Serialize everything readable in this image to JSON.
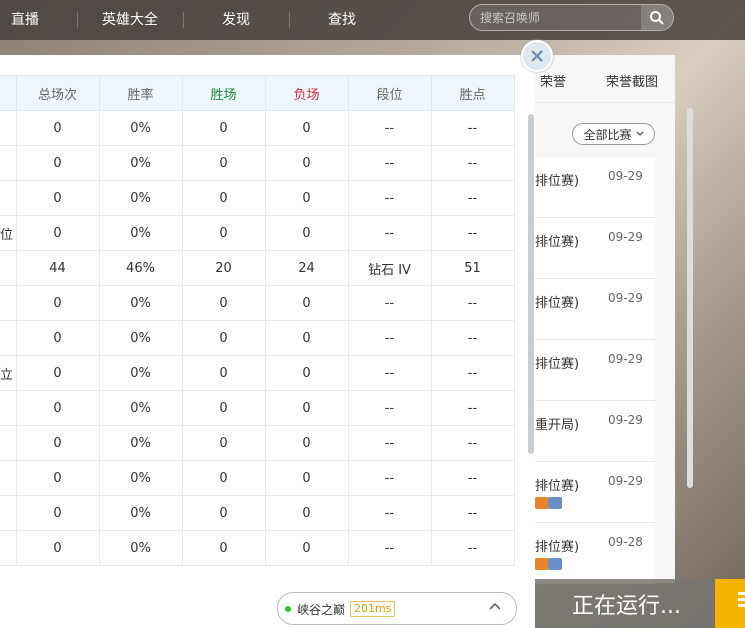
{
  "nav": {
    "items": [
      "直播",
      "英雄大全",
      "发现",
      "查找"
    ],
    "search_placeholder": "搜索召唤师"
  },
  "side": {
    "tabs": [
      "荣誉",
      "荣誉截图"
    ],
    "filter_label": "全部比赛",
    "matches": [
      {
        "name": "排位赛)",
        "date": "09-29"
      },
      {
        "name": "排位赛)",
        "date": "09-29"
      },
      {
        "name": "排位赛)",
        "date": "09-29"
      },
      {
        "name": "排位赛)",
        "date": "09-29"
      },
      {
        "name": "重开局)",
        "date": "09-29"
      },
      {
        "name": "排位赛)",
        "date": "09-29"
      },
      {
        "name": "排位赛)",
        "date": "09-28"
      }
    ]
  },
  "running_label": "正在运行...",
  "table": {
    "headers": [
      "总场次",
      "胜率",
      "胜场",
      "负场",
      "段位",
      "胜点"
    ],
    "rows": [
      {
        "mode": "",
        "total": "0",
        "rate": "0%",
        "win": "0",
        "lose": "0",
        "tier": "--",
        "points": "--"
      },
      {
        "mode": "",
        "total": "0",
        "rate": "0%",
        "win": "0",
        "lose": "0",
        "tier": "--",
        "points": "--"
      },
      {
        "mode": "",
        "total": "0",
        "rate": "0%",
        "win": "0",
        "lose": "0",
        "tier": "--",
        "points": "--"
      },
      {
        "mode": "位",
        "total": "0",
        "rate": "0%",
        "win": "0",
        "lose": "0",
        "tier": "--",
        "points": "--"
      },
      {
        "mode": "",
        "total": "44",
        "rate": "46%",
        "win": "20",
        "lose": "24",
        "tier": "钻石 IV",
        "points": "51"
      },
      {
        "mode": "",
        "total": "0",
        "rate": "0%",
        "win": "0",
        "lose": "0",
        "tier": "--",
        "points": "--"
      },
      {
        "mode": "",
        "total": "0",
        "rate": "0%",
        "win": "0",
        "lose": "0",
        "tier": "--",
        "points": "--"
      },
      {
        "mode": "立",
        "total": "0",
        "rate": "0%",
        "win": "0",
        "lose": "0",
        "tier": "--",
        "points": "--"
      },
      {
        "mode": "",
        "total": "0",
        "rate": "0%",
        "win": "0",
        "lose": "0",
        "tier": "--",
        "points": "--"
      },
      {
        "mode": "",
        "total": "0",
        "rate": "0%",
        "win": "0",
        "lose": "0",
        "tier": "--",
        "points": "--"
      },
      {
        "mode": "",
        "total": "0",
        "rate": "0%",
        "win": "0",
        "lose": "0",
        "tier": "--",
        "points": "--"
      },
      {
        "mode": "",
        "total": "0",
        "rate": "0%",
        "win": "0",
        "lose": "0",
        "tier": "--",
        "points": "--"
      },
      {
        "mode": "",
        "total": "0",
        "rate": "0%",
        "win": "0",
        "lose": "0",
        "tier": "--",
        "points": "--"
      }
    ]
  },
  "status": {
    "server": "峡谷之巅",
    "ping": "201ms"
  },
  "colors": {
    "win": "#1a8a3a",
    "lose": "#e0283a",
    "header_bg": "#eef5fb",
    "accent": "#f5b400"
  }
}
